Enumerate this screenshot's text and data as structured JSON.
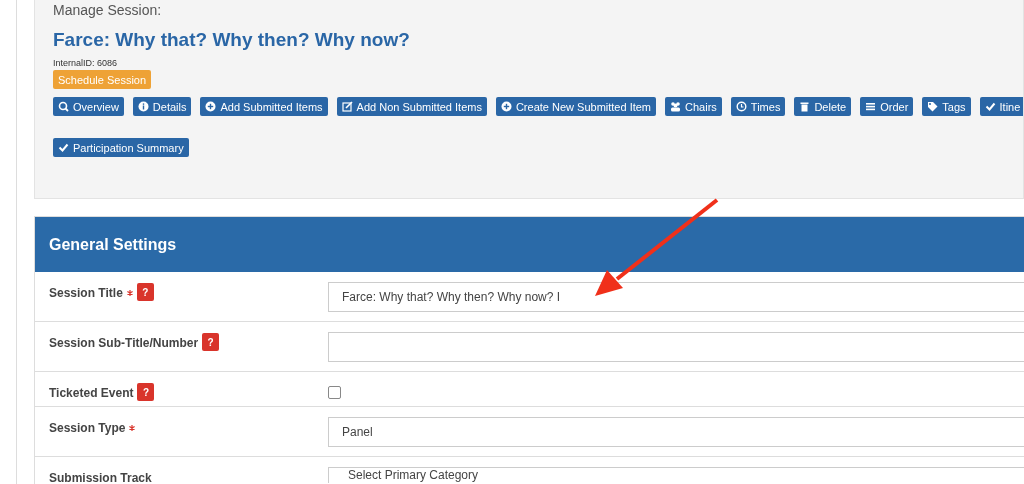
{
  "header": {
    "caption": "Manage Session:",
    "session_title": "Farce: Why that? Why then? Why now?",
    "internal_id": "InternalID: 6086",
    "schedule_button": "Schedule Session"
  },
  "toolbar_rows": [
    [
      "Overview",
      "Details",
      "Add Submitted Items",
      "Add Non Submitted Items",
      "Create New Submitted Item",
      "Chairs",
      "Times",
      "Delete",
      "Order",
      "Tags",
      "Itine"
    ],
    [
      "Participation Summary"
    ]
  ],
  "panel": {
    "title": "General Settings",
    "fields": [
      {
        "kind": "text",
        "label": "Session Title",
        "required": true,
        "help": "?",
        "value": "Farce: Why that? Why then? Why now? I"
      },
      {
        "kind": "text",
        "label": "Session Sub-Title/Number",
        "required": false,
        "help": "?"
      },
      {
        "kind": "checkbox",
        "label": "Ticketed Event",
        "required": false,
        "help": "?",
        "checked": false
      },
      {
        "kind": "text",
        "label": "Session Type",
        "required": true,
        "value": "Panel"
      },
      {
        "kind": "select",
        "label": "Submission Track",
        "required": false,
        "value": "Select Primary Category"
      }
    ]
  }
}
